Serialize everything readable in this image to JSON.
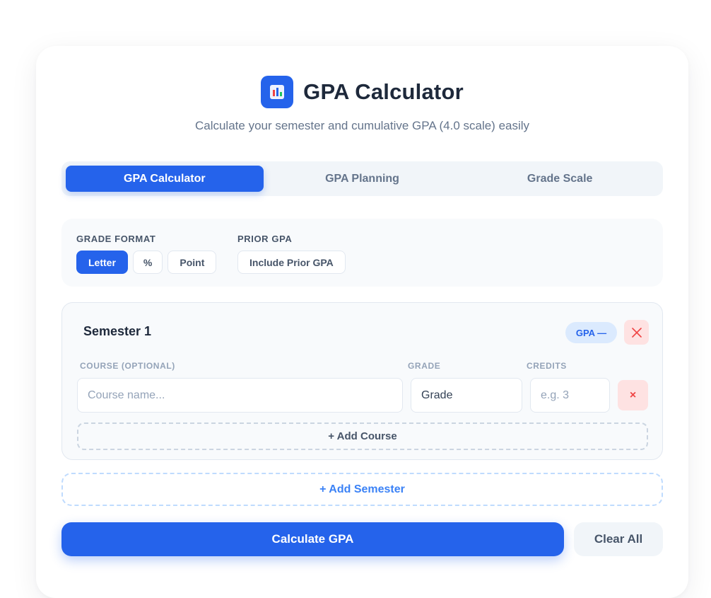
{
  "header": {
    "title": "GPA Calculator",
    "subtitle": "Calculate your semester and cumulative GPA (4.0 scale) easily",
    "logo_icon": "bar-chart-icon"
  },
  "tabs": [
    {
      "label": "GPA Calculator",
      "active": true
    },
    {
      "label": "GPA Planning",
      "active": false
    },
    {
      "label": "Grade Scale",
      "active": false
    }
  ],
  "options": {
    "grade_format": {
      "label": "GRADE FORMAT",
      "choices": [
        "Letter",
        "%",
        "Point"
      ],
      "selected": "Letter"
    },
    "prior_gpa": {
      "label": "PRIOR GPA",
      "button_label": "Include Prior GPA"
    }
  },
  "semester": {
    "title": "Semester 1",
    "gpa_badge": "GPA —",
    "remove_icon": "close-icon",
    "columns": {
      "course": "COURSE (OPTIONAL)",
      "grade": "GRADE",
      "credits": "CREDITS"
    },
    "course_row": {
      "course_placeholder": "Course name...",
      "grade_value": "Grade",
      "credits_placeholder": "e.g. 3",
      "remove_label": "×"
    },
    "add_course_label": "+ Add Course"
  },
  "add_semester_label": "+ Add Semester",
  "actions": {
    "calculate_label": "Calculate GPA",
    "clear_label": "Clear All"
  },
  "colors": {
    "accent": "#2563eb",
    "danger_bg": "#fee2e2",
    "danger": "#ef4444",
    "muted_bg": "#f1f5f9"
  }
}
